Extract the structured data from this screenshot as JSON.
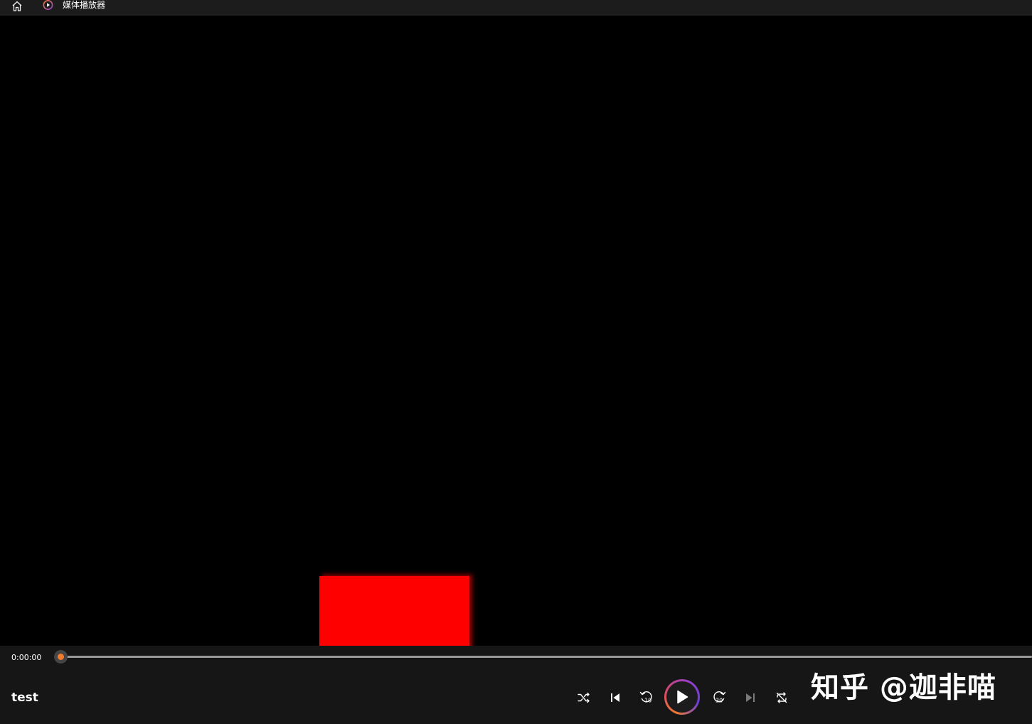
{
  "titlebar": {
    "home_icon": "home-icon",
    "app_icon": "media-player-icon",
    "app_title": "媒体播放器"
  },
  "video": {
    "frame_color": "#000000",
    "shape_color": "#ff0000"
  },
  "playback": {
    "current_time": "0:00:00",
    "progress": 0,
    "accent_color": "#f07a30"
  },
  "media": {
    "name": "test"
  },
  "controls": {
    "shuffle": "shuffle-icon",
    "previous": "skip-previous-icon",
    "rewind": "rewind-10-icon",
    "rewind_seconds": "10",
    "play": "play-icon",
    "forward": "forward-30-icon",
    "forward_seconds": "30",
    "next": "skip-next-icon",
    "repeat": "repeat-off-icon"
  },
  "watermark": {
    "text": "知乎 @迦非喵"
  }
}
